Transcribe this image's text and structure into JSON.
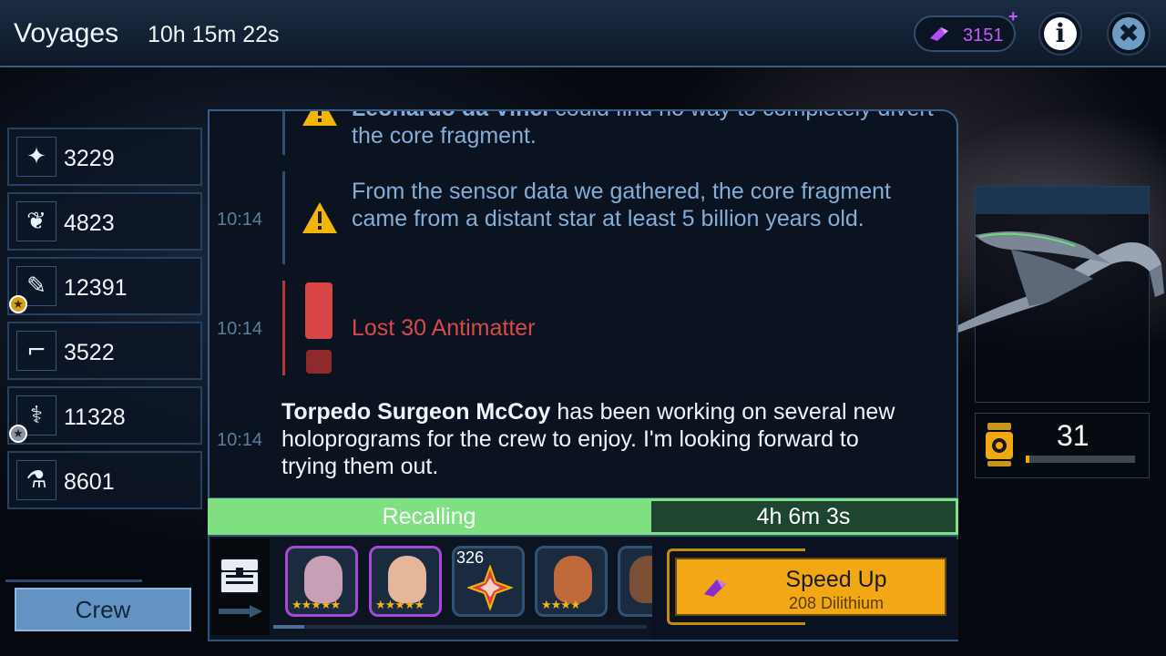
{
  "header": {
    "title": "Voyages",
    "timer": "10h 15m 22s",
    "dilithium": "3151",
    "dilithium_plus": "+",
    "info_glyph": "i",
    "close_glyph": "✖"
  },
  "skills": [
    {
      "icon": "command-icon",
      "glyph": "✦",
      "value": "3229",
      "starred": false
    },
    {
      "icon": "diplomacy-icon",
      "glyph": "❦",
      "value": "4823",
      "starred": false
    },
    {
      "icon": "engineering-icon",
      "glyph": "✎",
      "value": "12391",
      "starred": true,
      "star_color": "#d9a213"
    },
    {
      "icon": "security-icon",
      "glyph": "⌐",
      "value": "3522",
      "starred": false
    },
    {
      "icon": "medicine-icon",
      "glyph": "⚕",
      "value": "11328",
      "starred": true,
      "star_color": "#8c96a3"
    },
    {
      "icon": "science-icon",
      "glyph": "⚗",
      "value": "8601",
      "starred": false
    }
  ],
  "crew_button": "Crew",
  "log": {
    "entry0": {
      "text": "Leonardo da Vinci could find no way to completely divert the core fragment.",
      "bold_name": "Leonardo da Vinci",
      "rest": " could find no way to completely divert the core fragment."
    },
    "entry1": {
      "time": "10:14",
      "text": "From the sensor data we gathered, the core fragment came from a distant star at least 5 billion years old."
    },
    "entry2": {
      "time": "10:14",
      "text": "Lost 30 Antimatter"
    },
    "entry3": {
      "time": "10:14",
      "bold_name": "Torpedo Surgeon McCoy",
      "rest": " has been working on several new holoprograms for the crew to enjoy. I'm looking forward to trying them out."
    }
  },
  "status": {
    "label": "Recalling",
    "remaining": "4h 6m 3s"
  },
  "crew_strip": {
    "item_count": "326",
    "portraits": [
      {
        "name": "crew-portrait-1",
        "rarity": "legendary",
        "face": "#c8a0b6",
        "stars": "★★★★★"
      },
      {
        "name": "crew-portrait-2",
        "rarity": "legendary",
        "face": "#e4b79a",
        "stars": "★★★★★"
      },
      {
        "name": "crew-portrait-3",
        "rarity": "item",
        "face": "#d94040",
        "stars": ""
      },
      {
        "name": "crew-portrait-4",
        "rarity": "common",
        "face": "#c06a3c",
        "stars": "★★★★"
      },
      {
        "name": "crew-portrait-5",
        "rarity": "common",
        "face": "#7a4f36",
        "stars": ""
      }
    ]
  },
  "speed_up": {
    "label": "Speed Up",
    "cost": "208 Dilithium"
  },
  "antimatter": {
    "value": "31",
    "fraction": 0.03
  },
  "colors": {
    "dilithium": "#c45cff",
    "recall_green": "#7ee081",
    "speed_gold": "#f2a814",
    "warning_yellow": "#f2b705",
    "loss_red": "#d64a4a"
  }
}
